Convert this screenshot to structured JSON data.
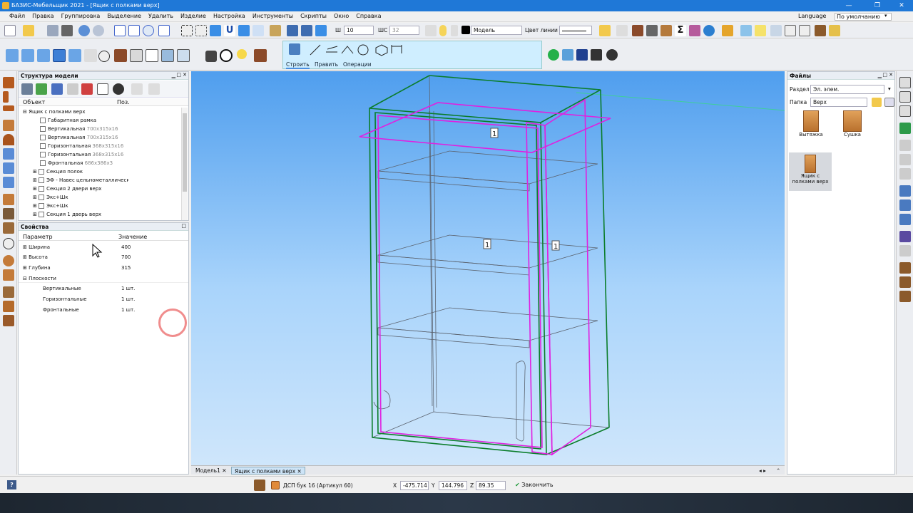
{
  "window": {
    "title": "БАЗИС-Мебельщик 2021 - [Ящик с полками верх]"
  },
  "menu": [
    "Файл",
    "Правка",
    "Группировка",
    "Выделение",
    "Удалить",
    "Изделие",
    "Настройка",
    "Инструменты",
    "Скрипты",
    "Окно",
    "Справка"
  ],
  "menu_right": {
    "language": "Language",
    "default": "По умолчанию"
  },
  "toolbar": {
    "w_label": "Ш",
    "w_value": "10",
    "wc_label": "ШС",
    "wc_value": "32",
    "layer_value": "Модель",
    "line_color_label": "Цвет линии"
  },
  "draw_toolbar": {
    "tabs": [
      "Строить",
      "Править",
      "Операции"
    ]
  },
  "structure": {
    "title": "Структура модели",
    "col_object": "Объект",
    "col_pos": "Поз.",
    "root": "Ящик с полками верх",
    "items": [
      {
        "name": "Габаритная рамка",
        "dim": ""
      },
      {
        "name": "Вертикальная",
        "dim": "700x315x16"
      },
      {
        "name": "Вертикальная",
        "dim": "700x315x16"
      },
      {
        "name": "Горизонтальная",
        "dim": "368x315x16"
      },
      {
        "name": "Горизонтальная",
        "dim": "368x315x16"
      },
      {
        "name": "Фронтальная",
        "dim": "686x386x3"
      },
      {
        "name": "Секция полок",
        "dim": ""
      },
      {
        "name": "ЭФ - Навес цельнометаллический",
        "dim": ""
      },
      {
        "name": "Секция 2 двери верх",
        "dim": ""
      },
      {
        "name": "Экс+Шк",
        "dim": ""
      },
      {
        "name": "Экс+Шк",
        "dim": ""
      },
      {
        "name": "Секция 1 дверь верх",
        "dim": ""
      }
    ]
  },
  "properties": {
    "title": "Свойства",
    "col_param": "Параметр",
    "col_value": "Значение",
    "rows": [
      {
        "name": "Ширина",
        "value": "400"
      },
      {
        "name": "Высота",
        "value": "700"
      },
      {
        "name": "Глубина",
        "value": "315"
      },
      {
        "name": "Плоскости",
        "value": ""
      }
    ],
    "sub": [
      {
        "name": "Вертикальные",
        "value": "1 шт."
      },
      {
        "name": "Горизонтальные",
        "value": "1 шт."
      },
      {
        "name": "Фронтальные",
        "value": "1 шт."
      }
    ]
  },
  "viewport": {
    "labels": [
      "1",
      "1",
      "1"
    ]
  },
  "files": {
    "title": "Файлы",
    "section_label": "Раздел",
    "section_value": "Эл. элем.",
    "folder_label": "Папка",
    "folder_value": "Верх",
    "tiles": [
      "Вытяжка",
      "Сушка",
      "Ящик с полками верх"
    ]
  },
  "tabs": [
    "Модель1",
    "Ящик с полками верх"
  ],
  "status": {
    "material": "ДСП бук 16 (Артикул 60)",
    "x_label": "X",
    "x_value": "-475.714",
    "y_label": "Y",
    "y_value": "144.796",
    "z_label": "Z",
    "z_value": "89.35",
    "finish": "Закончить",
    "help": "?"
  }
}
